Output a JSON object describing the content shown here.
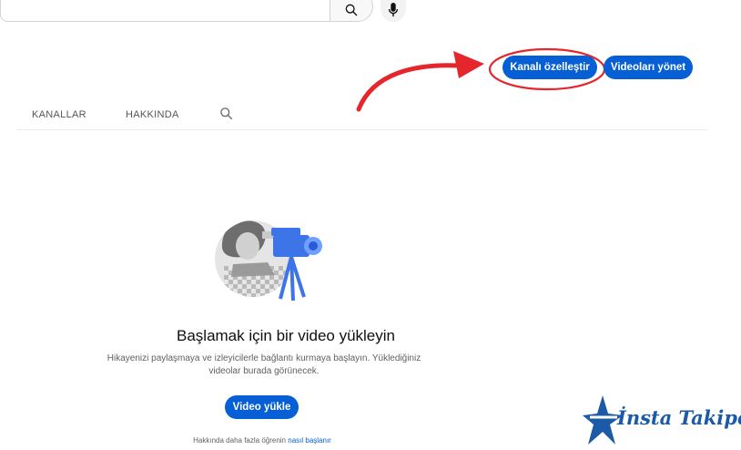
{
  "header": {
    "search_icon": "search-icon",
    "mic_icon": "mic-icon"
  },
  "actions": {
    "customize_label": "Kanalı özelleştir",
    "manage_label": "Videoları yönet"
  },
  "tabs": [
    {
      "label": "KANALLAR"
    },
    {
      "label": "HAKKINDA"
    }
  ],
  "empty_state": {
    "title": "Başlamak için bir video yükleyin",
    "description": "Hikayenizi paylaşmaya ve izleyicilerle bağlantı kurmaya başlayın. Yüklediğiniz videolar burada görünecek.",
    "upload_label": "Video yükle",
    "learn_prefix": "Hakkında daha fazla öğrenin",
    "learn_link": "nasıl başlanır"
  },
  "annotation": {
    "color": "#e5262d"
  },
  "watermark": {
    "text": "İnsta Takipci",
    "color": "#1a5aa6"
  }
}
